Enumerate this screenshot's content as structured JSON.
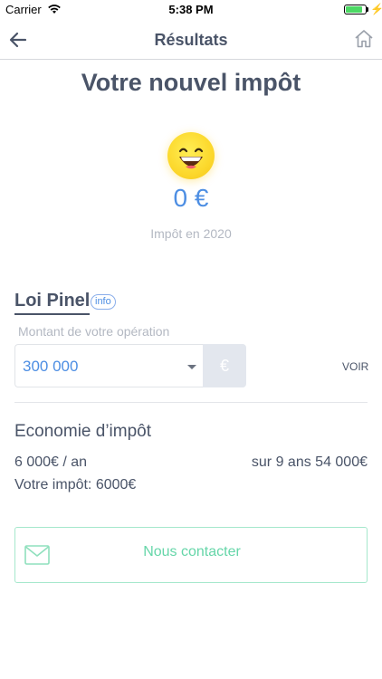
{
  "status_bar": {
    "carrier": "Carrier",
    "time": "5:38 PM",
    "battery_level": 0.85,
    "battery_color": "#4cd964"
  },
  "navbar": {
    "title": "Résultats",
    "back_icon": "arrow-left-icon",
    "home_icon": "home-icon"
  },
  "result": {
    "title": "Votre nouvel impôt",
    "emoji": "grinning-face",
    "amount": "0 €",
    "caption": "Impôt en 2020"
  },
  "pinel": {
    "title": "Loi Pinel",
    "info_label": "info",
    "field_label": "Montant de votre opération",
    "selected_value": "300 000",
    "unit": "€",
    "voir_label": "VOIR"
  },
  "economie": {
    "title": "Economie d’impôt",
    "per_year": "6 000€ / an",
    "total": "sur 9 ans 54 000€",
    "your_tax": "Votre impôt: 6000€"
  },
  "contact": {
    "label": "Nous contacter",
    "icon": "mail-icon"
  },
  "colors": {
    "accent_blue": "#4d8ee3",
    "text_dark": "#4a5468",
    "contact_green": "#66d6a9"
  }
}
